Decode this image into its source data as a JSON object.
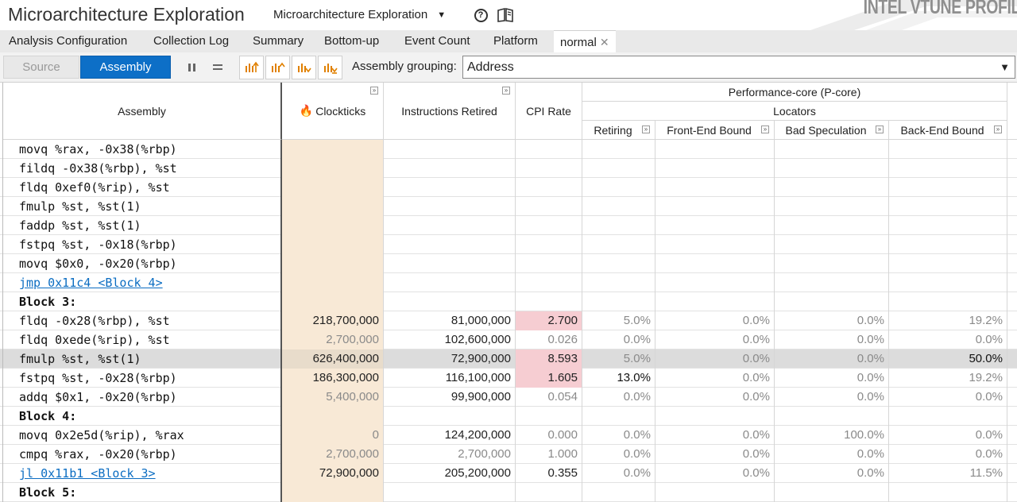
{
  "titlebar": {
    "app_title": "Microarchitecture Exploration",
    "analysis_type": "Microarchitecture Exploration",
    "brand": "INTEL VTUNE PROFIL"
  },
  "tabs": [
    {
      "label": "Analysis Configuration"
    },
    {
      "label": "Collection Log"
    },
    {
      "label": "Summary"
    },
    {
      "label": "Bottom-up"
    },
    {
      "label": "Event Count"
    },
    {
      "label": "Platform"
    },
    {
      "label": "normal",
      "active": true
    }
  ],
  "toolbar": {
    "source_label": "Source",
    "assembly_label": "Assembly",
    "grouping_label": "Assembly grouping:",
    "grouping_value": "Address"
  },
  "headers": {
    "assembly": "Assembly",
    "clockticks": "Clockticks",
    "instructions": "Instructions Retired",
    "cpi": "CPI Rate",
    "pcore": "Performance-core (P-core)",
    "locators": "Locators",
    "retiring": "Retiring",
    "frontend": "Front-End Bound",
    "badspec": "Bad Speculation",
    "backend": "Back-End Bound"
  },
  "colors": {
    "accent": "#0d6fc7",
    "clockticks_bg": "#f8e9d6",
    "cpi_high_bg": "#f6cdd2",
    "selected_row": "#dcdcdc"
  },
  "rows": [
    {
      "asm": "movq  %rax, -0x38(%rbp)"
    },
    {
      "asm": "fildq  -0x38(%rbp), %st"
    },
    {
      "asm": "fldq  0xef0(%rip), %st"
    },
    {
      "asm": "fmulp %st, %st(1)"
    },
    {
      "asm": "faddp %st, %st(1)"
    },
    {
      "asm": "fstpq  %st, -0x18(%rbp)"
    },
    {
      "asm": "movq  $0x0, -0x20(%rbp)"
    },
    {
      "asm": "jmp 0x11c4 <Block 4>",
      "link": true
    },
    {
      "asm": "Block 3:",
      "block": true
    },
    {
      "asm": "fldq  -0x28(%rbp), %st",
      "clk": "218,700,000",
      "ins": "81,000,000",
      "cpi": "2.700",
      "cpi_high": true,
      "ret": "5.0%",
      "fe": "0.0%",
      "bs": "0.0%",
      "be": "19.2%"
    },
    {
      "asm": "fldq  0xede(%rip), %st",
      "clk": "2,700,000",
      "clk_dim": true,
      "ins": "102,600,000",
      "cpi": "0.026",
      "cpi_dim": true,
      "ret": "0.0%",
      "fe": "0.0%",
      "bs": "0.0%",
      "be": "0.0%"
    },
    {
      "asm": "fmulp %st, %st(1)",
      "selected": true,
      "clk": "626,400,000",
      "ins": "72,900,000",
      "cpi": "8.593",
      "cpi_high": true,
      "ret": "5.0%",
      "fe": "0.0%",
      "bs": "0.0%",
      "be": "50.0%",
      "be_strong": true
    },
    {
      "asm": "fstpq  %st, -0x28(%rbp)",
      "clk": "186,300,000",
      "ins": "116,100,000",
      "cpi": "1.605",
      "cpi_high": true,
      "ret": "13.0%",
      "ret_strong": true,
      "fe": "0.0%",
      "bs": "0.0%",
      "be": "19.2%"
    },
    {
      "asm": "addq  $0x1, -0x20(%rbp)",
      "clk": "5,400,000",
      "clk_dim": true,
      "ins": "99,900,000",
      "cpi": "0.054",
      "cpi_dim": true,
      "ret": "0.0%",
      "fe": "0.0%",
      "bs": "0.0%",
      "be": "0.0%"
    },
    {
      "asm": "Block 4:",
      "block": true
    },
    {
      "asm": "movq  0x2e5d(%rip), %rax",
      "clk": "0",
      "clk_dim": true,
      "ins": "124,200,000",
      "cpi": "0.000",
      "cpi_dim": true,
      "ret": "0.0%",
      "fe": "0.0%",
      "bs": "100.0%",
      "be": "0.0%"
    },
    {
      "asm": "cmpq  %rax, -0x20(%rbp)",
      "clk": "2,700,000",
      "clk_dim": true,
      "ins": "2,700,000",
      "ins_dim": true,
      "cpi": "1.000",
      "cpi_dim": true,
      "ret": "0.0%",
      "fe": "0.0%",
      "bs": "0.0%",
      "be": "0.0%"
    },
    {
      "asm": "jl 0x11b1 <Block 3>",
      "link": true,
      "clk": "72,900,000",
      "ins": "205,200,000",
      "cpi": "0.355",
      "ret": "0.0%",
      "fe": "0.0%",
      "bs": "0.0%",
      "be": "11.5%"
    },
    {
      "asm": "Block 5:",
      "block": true
    }
  ]
}
